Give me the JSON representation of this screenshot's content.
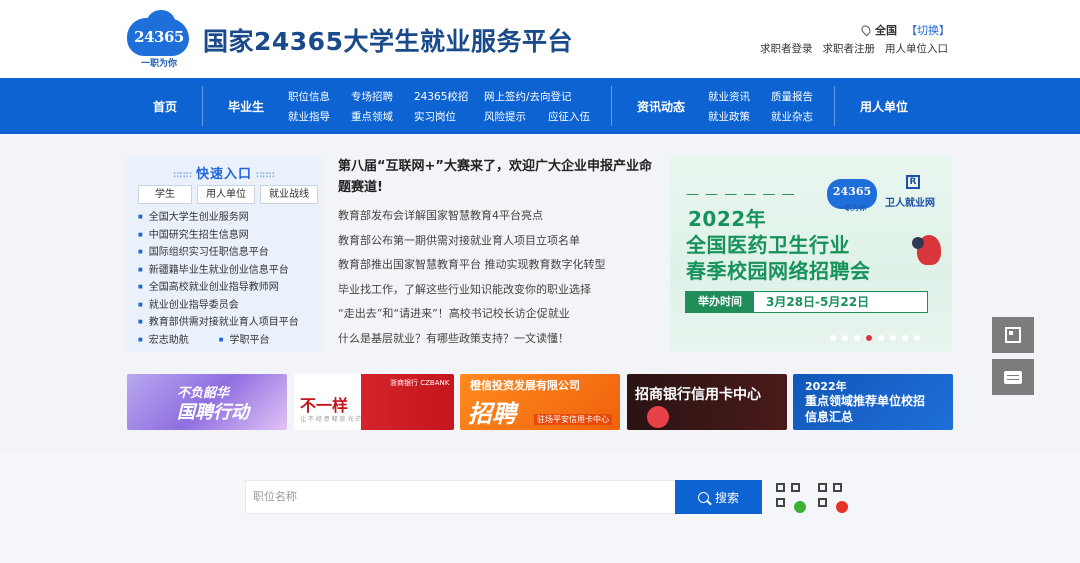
{
  "header": {
    "logo_number": "24365",
    "logo_slogan": "一职为你",
    "title": "国家24365大学生就业服务平台",
    "region": "全国",
    "region_switch": "【切换】",
    "links": [
      "求职者登录",
      "求职者注册",
      "用人单位入口"
    ]
  },
  "nav": {
    "home": "首页",
    "graduates": "毕业生",
    "graduate_links": [
      [
        "职位信息",
        "就业指导"
      ],
      [
        "专场招聘",
        "重点领域"
      ],
      [
        "24365校招",
        "实习岗位"
      ],
      [
        "网上签约/去向登记",
        "风险提示"
      ],
      [
        "",
        "应征入伍"
      ]
    ],
    "news": "资讯动态",
    "news_links": [
      [
        "就业资讯",
        "就业政策"
      ],
      [
        "质量报告",
        "就业杂志"
      ]
    ],
    "employers": "用人单位"
  },
  "quick": {
    "title": "快速入口",
    "tabs": [
      "学生",
      "用人单位",
      "就业战线"
    ],
    "items": [
      "全国大学生创业服务网",
      "中国研究生招生信息网",
      "国际组织实习任职信息平台",
      "新疆籍毕业生就业创业信息平台",
      "全国高校就业创业指导教师网",
      "就业创业指导委员会",
      "教育部供需对接就业育人项目平台"
    ],
    "last_row": [
      "宏志助航",
      "学职平台"
    ]
  },
  "news": {
    "headline": "第八届“互联网+”大赛来了，欢迎广大企业申报产业命题赛道!",
    "items": [
      "教育部发布会详解国家智慧教育4平台亮点",
      "教育部公布第一期供需对接就业育人项目立项名单",
      "教育部推出国家智慧教育平台 推动实现教育数字化转型",
      "毕业找工作，了解这些行业知识能改变你的职业选择",
      "“走出去”和“请进来”！高校书记校长访企促就业",
      "什么是基层就业？有哪些政策支持？一文读懂！"
    ]
  },
  "banner": {
    "dash": "— — — — — —",
    "logo_number": "24365",
    "logo_slogan": "一职为你",
    "partner_mark": "R",
    "partner": "卫人就业网",
    "line1": "2022年",
    "line2": "全国医药卫生行业",
    "line3": "春季校园网络招聘会",
    "time_label": "举办时间",
    "time_value": "3月28日-5月22日",
    "dots": 8,
    "active_dot": 3
  },
  "ads": [
    {
      "line1": "不负韶华",
      "line2": "国聘行动"
    },
    {
      "line1": "不一样",
      "logo": "浙商银行 CZBANK",
      "sub": "让 不 经 意 释 放 光 芒"
    },
    {
      "line1": "橙信投资发展有限公司",
      "line2": "招聘",
      "sub": "驻场平安信用卡中心"
    },
    {
      "line1": "招商银行信用卡中心"
    },
    {
      "line1": "2022年",
      "line2": "重点领域推荐单位校招",
      "line3": "信息汇总"
    }
  ],
  "search": {
    "placeholder": "职位名称",
    "button": "搜索"
  },
  "colors": {
    "primary": "#0e63d3",
    "title": "#1a4a8a",
    "banner_green": "#17925a"
  }
}
